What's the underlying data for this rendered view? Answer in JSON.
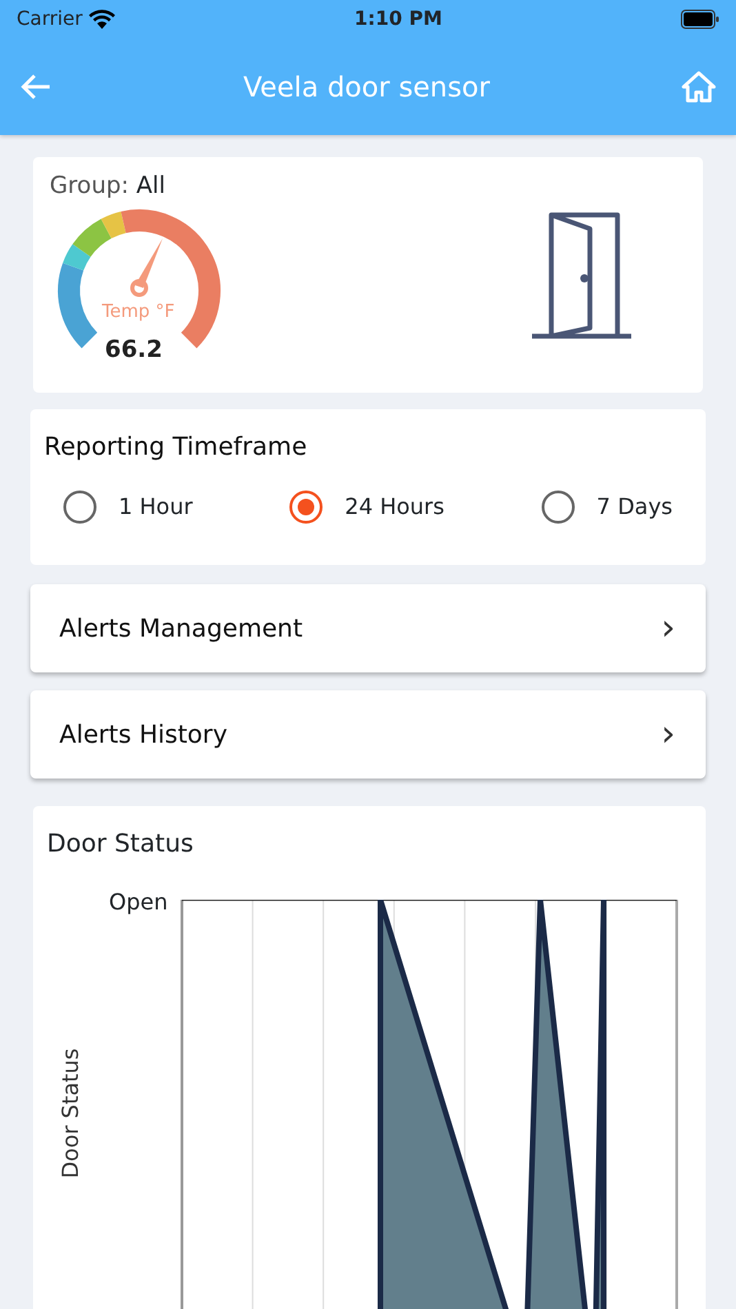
{
  "status_bar": {
    "carrier": "Carrier",
    "time": "1:10 PM"
  },
  "app_bar": {
    "title": "Veela door sensor"
  },
  "sensor_card": {
    "group_label": "Group:",
    "group_value": "All",
    "gauge": {
      "label": "Temp °F",
      "reading": "66.2"
    }
  },
  "timeframe": {
    "title": "Reporting Timeframe",
    "options": [
      {
        "label": "1 Hour",
        "selected": false
      },
      {
        "label": "24 Hours",
        "selected": true
      },
      {
        "label": "7 Days",
        "selected": false
      }
    ]
  },
  "menu": [
    {
      "label": "Alerts Management",
      "chevron": "›"
    },
    {
      "label": "Alerts History",
      "chevron": "›"
    }
  ],
  "door_status": {
    "title": "Door Status",
    "ylabel": "Door Status",
    "ytick": "Open"
  }
}
